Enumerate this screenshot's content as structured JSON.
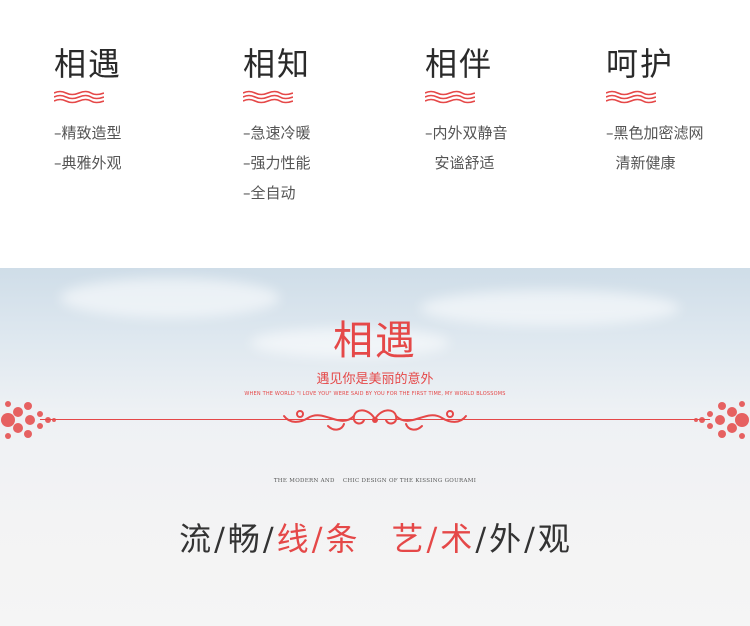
{
  "features": [
    {
      "title": "相遇",
      "items": [
        "–精致造型",
        "–典雅外观"
      ]
    },
    {
      "title": "相知",
      "items": [
        "–急速冷暖",
        "–强力性能",
        "–全自动"
      ]
    },
    {
      "title": "相伴",
      "items": [
        "–内外双静音",
        "  安谧舒适"
      ]
    },
    {
      "title": "呵护",
      "items": [
        "–黑色加密滤网",
        "  清新健康"
      ]
    }
  ],
  "banner": {
    "title": "相遇",
    "subtitle": "遇见你是美丽的意外",
    "english": "WHEN THE WORLD \"I LOVE YOU\" WERE SAID BY YOU FOR THE FIRST TIME, MY WORLD BLOSSOMS",
    "tagline": "THE MODERN AND    CHIC DESIGN OF THE KISSING GOURAMI",
    "slogan": [
      {
        "text": "流",
        "color": "#333333"
      },
      {
        "text": "/",
        "color": "#333333"
      },
      {
        "text": "畅",
        "color": "#333333"
      },
      {
        "text": "/",
        "color": "#333333"
      },
      {
        "text": "线",
        "color": "#e54848"
      },
      {
        "text": "/",
        "color": "#e54848"
      },
      {
        "text": "条",
        "color": "#e54848"
      },
      {
        "text": "　",
        "color": "#333333"
      },
      {
        "text": "艺",
        "color": "#e54848"
      },
      {
        "text": "/",
        "color": "#e54848"
      },
      {
        "text": "术",
        "color": "#e54848"
      },
      {
        "text": "/",
        "color": "#333333"
      },
      {
        "text": "外",
        "color": "#333333"
      },
      {
        "text": "/",
        "color": "#333333"
      },
      {
        "text": "观",
        "color": "#333333"
      }
    ]
  },
  "colors": {
    "accent": "#e54848",
    "text": "#2a2a2a",
    "muted": "#555555"
  },
  "icons": {
    "wave": "red-wave-icon",
    "ornament": "red-scroll-ornament",
    "floral": "red-floral-ornament"
  }
}
